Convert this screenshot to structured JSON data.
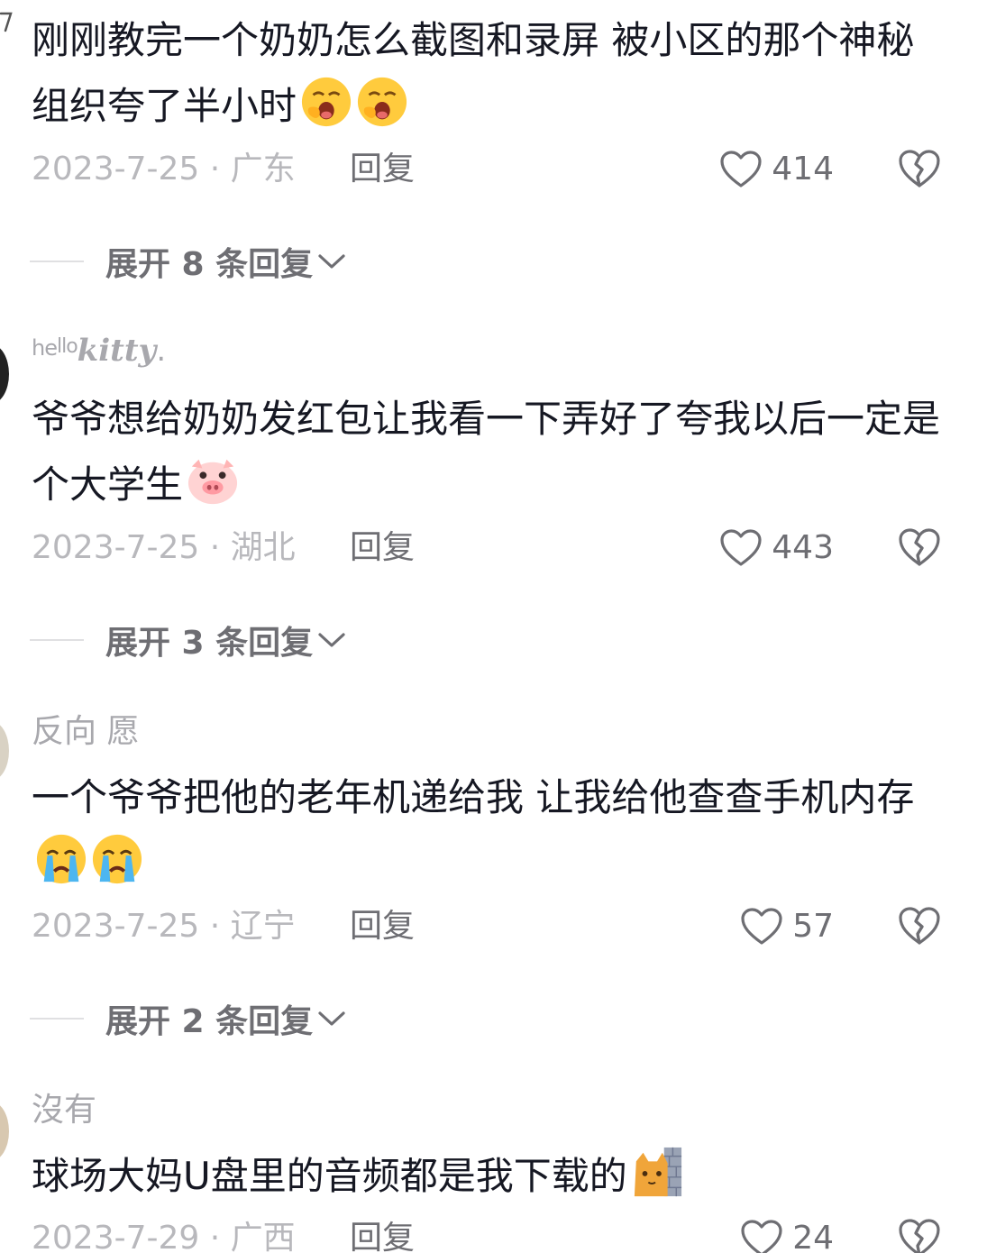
{
  "comments": [
    {
      "username": "",
      "text": "刚刚教完一个奶奶怎么截图和录屏 被小区的那个神秘组织夸了半小时",
      "emojis": [
        "yawn-emoji",
        "yawn-emoji"
      ],
      "date_location": "2023-7-25 · 广东",
      "reply_label": "回复",
      "likes": "414",
      "expand_label": "展开 8 条回复"
    },
    {
      "username": "hello kitty.",
      "text": "爷爷想给奶奶发红包让我看一下弄好了夸我以后一定是个大学生",
      "emojis": [
        "pig-emoji"
      ],
      "date_location": "2023-7-25 · 湖北",
      "reply_label": "回复",
      "likes": "443",
      "expand_label": "展开 3 条回复"
    },
    {
      "username": "反向 愿",
      "text": "一个爷爷把他的老年机递给我 让我给他查查手机内存",
      "emojis": [
        "crying-emoji",
        "crying-emoji"
      ],
      "date_location": "2023-7-25 · 辽宁",
      "reply_label": "回复",
      "likes": "57",
      "expand_label": "展开 2 条回复"
    },
    {
      "username": "沒有",
      "text": "球场大妈U盘里的音频都是我下载的",
      "emojis": [
        "cat-wall-emoji"
      ],
      "date_location": "2023-7-29 · 广西",
      "reply_label": "回复",
      "likes": "24"
    }
  ],
  "colors": {
    "text": "#161823",
    "secondary": "#a8a8ad",
    "meta": "#b8b8bc",
    "action": "#6e6e73"
  }
}
